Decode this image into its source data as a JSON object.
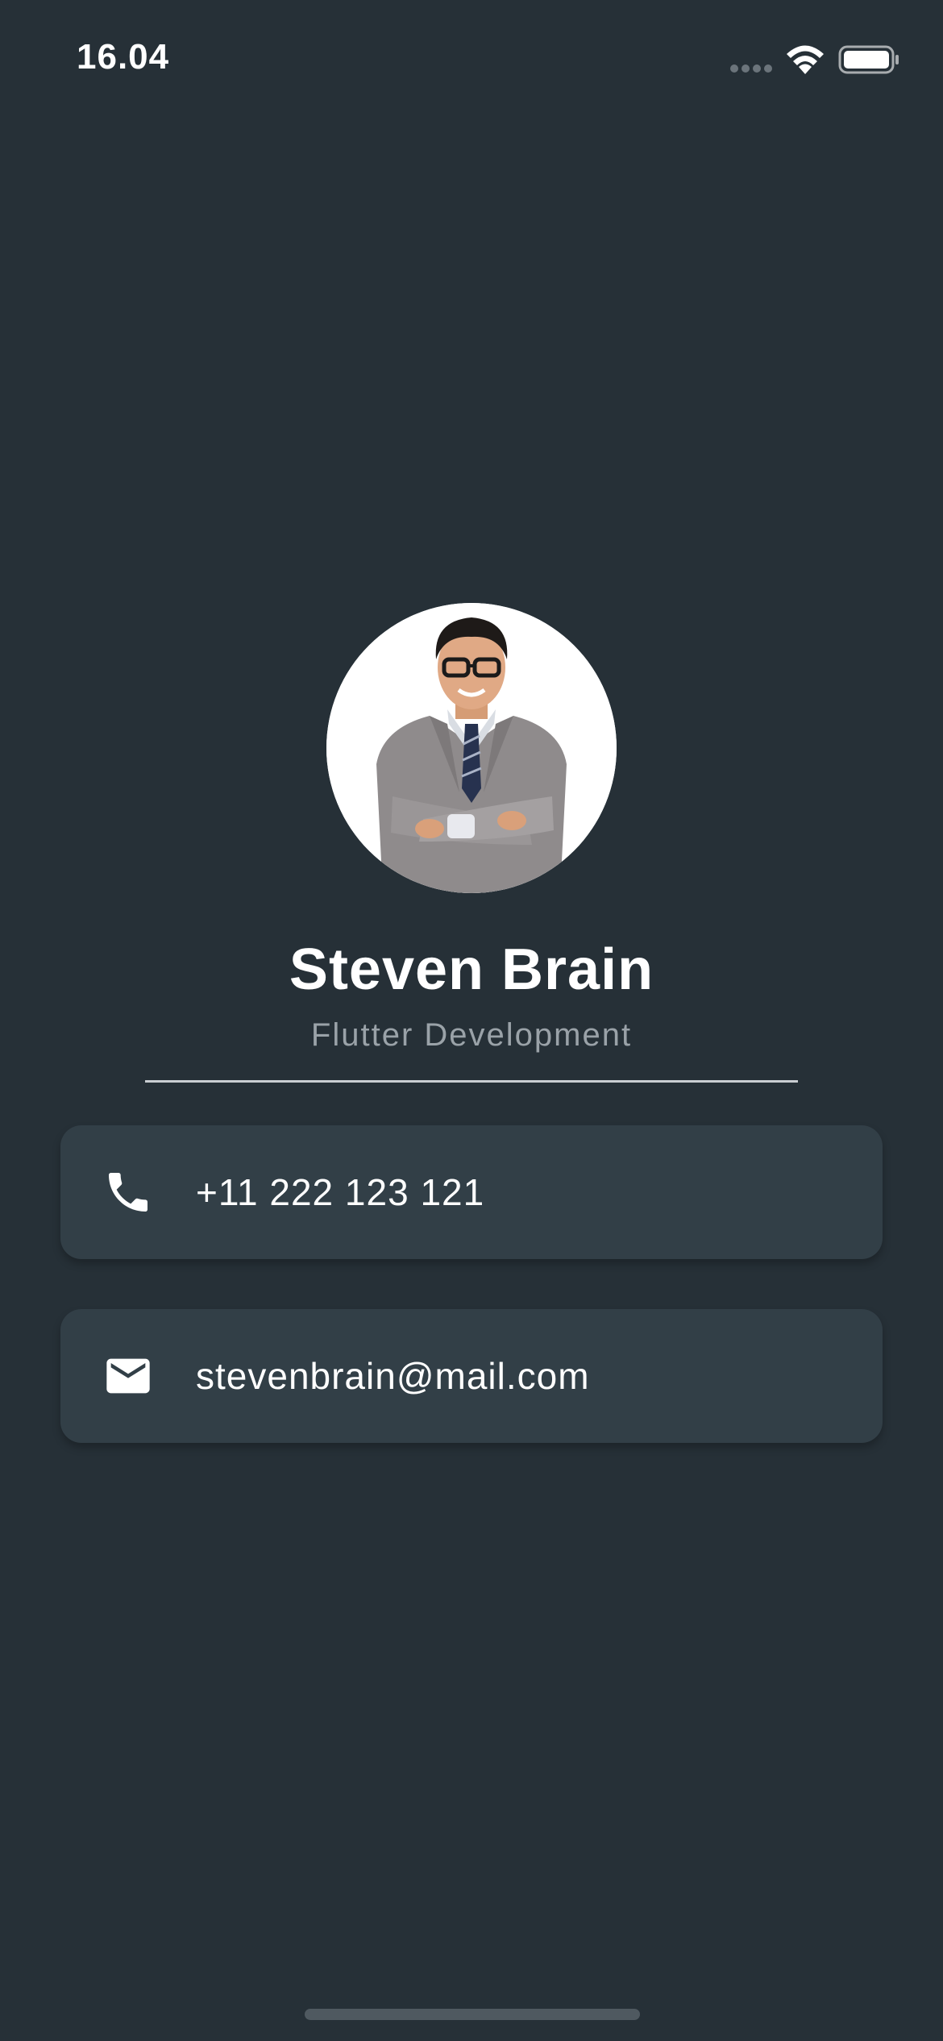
{
  "status_bar": {
    "time": "16.04"
  },
  "profile": {
    "name": "Steven Brain",
    "role": "Flutter Development"
  },
  "contacts": [
    {
      "icon": "phone-icon",
      "value": "+11 222 123 121"
    },
    {
      "icon": "mail-icon",
      "value": "stevenbrain@mail.com"
    }
  ],
  "colors": {
    "background": "#263037",
    "card": "#323f47",
    "text": "#ffffff",
    "subtitle": "#9aa2a8",
    "divider": "#c9ced2"
  }
}
